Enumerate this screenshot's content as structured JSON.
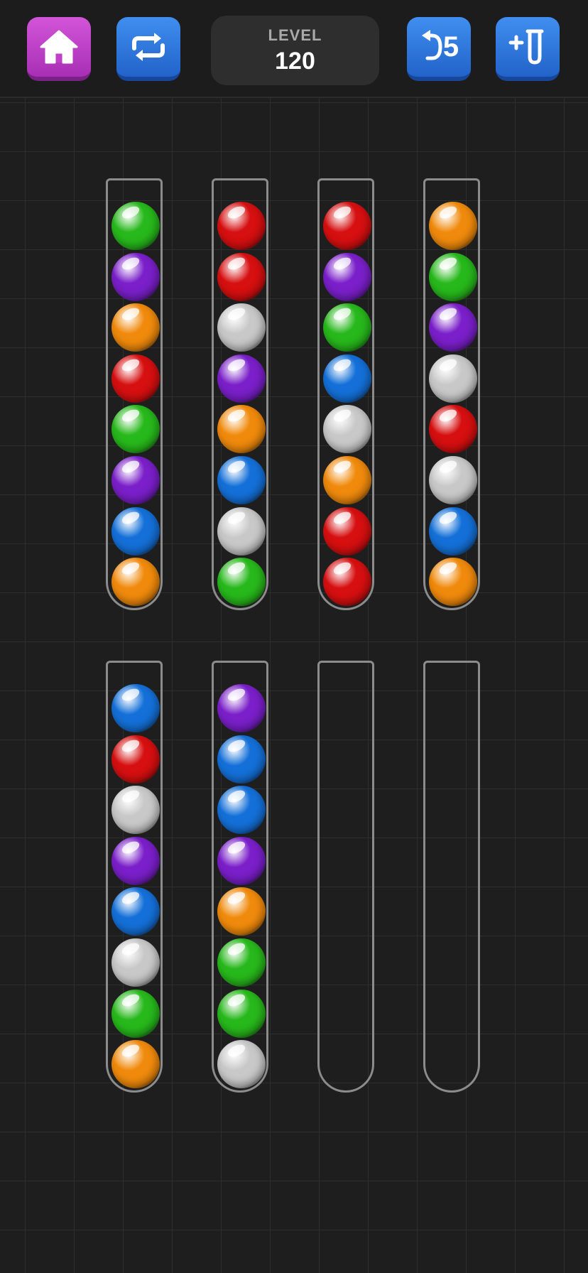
{
  "header": {
    "level_label": "LEVEL",
    "level_number": "120",
    "undo_count": "5",
    "buttons": {
      "home_icon": "home-icon",
      "restart_icon": "repeat-icon",
      "undo_icon": "undo-icon",
      "add_tube_icon": "add-tube-icon"
    }
  },
  "colors": {
    "green": "#27b81b",
    "purple": "#7a1fc9",
    "orange": "#f08a0c",
    "red": "#d60f10",
    "blue": "#1470d8",
    "white": "#c8c8c8"
  },
  "tubes": [
    [
      "green",
      "purple",
      "orange",
      "red",
      "green",
      "purple",
      "blue",
      "orange"
    ],
    [
      "red",
      "red",
      "white",
      "purple",
      "orange",
      "blue",
      "white",
      "green"
    ],
    [
      "red",
      "purple",
      "green",
      "blue",
      "white",
      "orange",
      "red",
      "red"
    ],
    [
      "orange",
      "green",
      "purple",
      "white",
      "red",
      "white",
      "blue",
      "orange"
    ],
    [
      "blue",
      "red",
      "white",
      "purple",
      "blue",
      "white",
      "green",
      "orange"
    ],
    [
      "purple",
      "blue",
      "blue",
      "purple",
      "orange",
      "green",
      "green",
      "white"
    ],
    [],
    []
  ]
}
